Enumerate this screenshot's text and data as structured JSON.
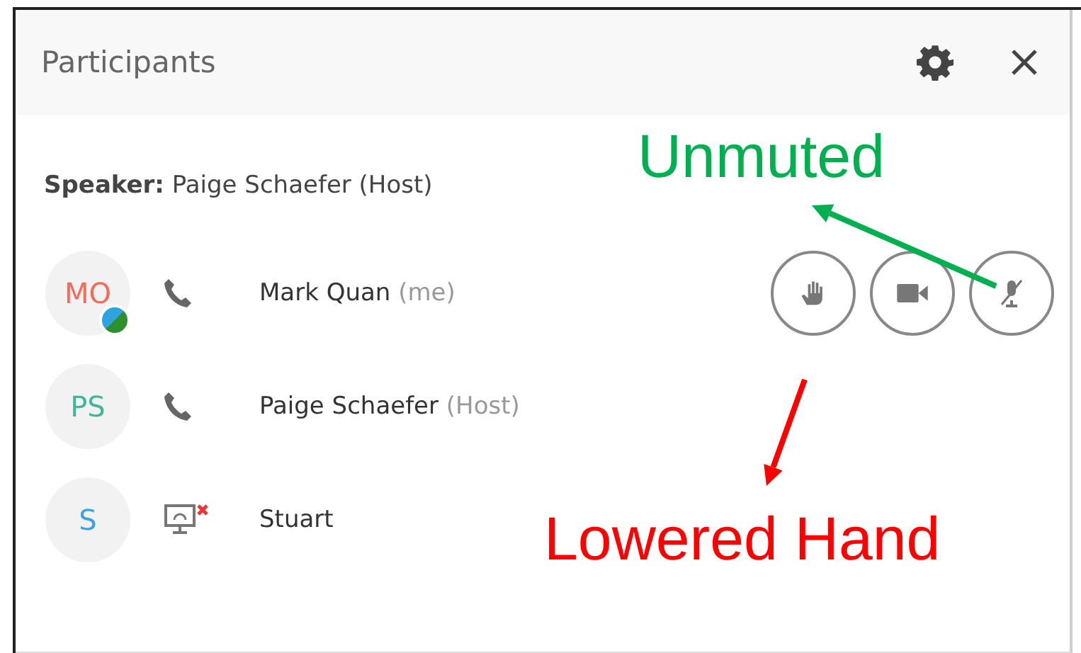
{
  "window": {
    "title": "Participants"
  },
  "speaker": {
    "label": "Speaker:",
    "name": "Paige Schaefer (Host)"
  },
  "participants": [
    {
      "initials": "MO",
      "color": "#f26b5b",
      "kind": "phone",
      "name": "Mark Quan",
      "suffix": "(me)",
      "badge": true,
      "controls": [
        {
          "kind": "hand"
        },
        {
          "kind": "video"
        },
        {
          "kind": "mic"
        }
      ]
    },
    {
      "initials": "PS",
      "color": "#3fb89a",
      "kind": "phone",
      "name": "Paige Schaefer",
      "suffix": "(Host)",
      "badge": false
    },
    {
      "initials": "S",
      "color": "#3aa3e0",
      "kind": "screen",
      "name": "Stuart",
      "badge": false
    }
  ],
  "annotations": [
    {
      "kind": "unmuted",
      "text": "Unmuted",
      "color": "#00b050"
    },
    {
      "kind": "hand",
      "text": "Lowered Hand",
      "color": "#ff0000"
    }
  ]
}
